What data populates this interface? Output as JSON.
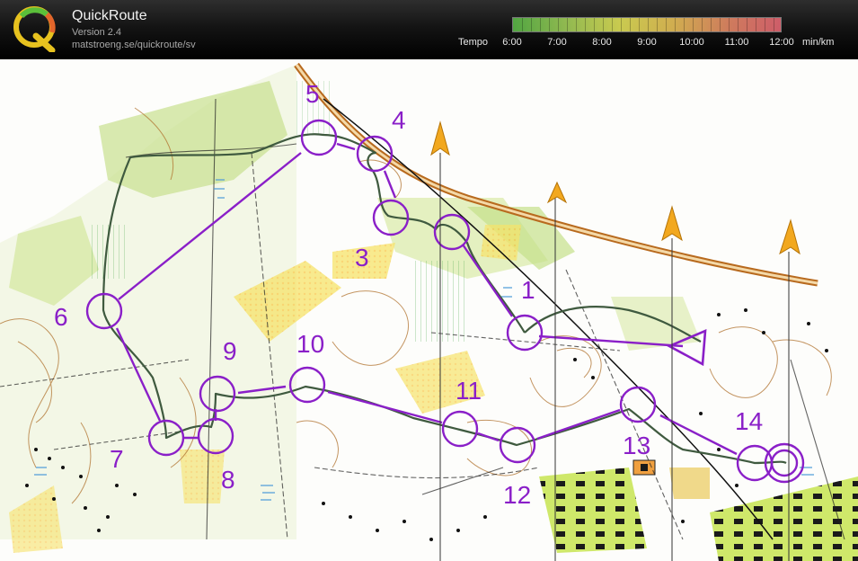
{
  "app": {
    "title": "QuickRoute",
    "version": "Version 2.4",
    "url": "matstroeng.se/quickroute/sv",
    "logo_letter": "Q"
  },
  "legend": {
    "label": "Tempo",
    "ticks": [
      "6:00",
      "7:00",
      "8:00",
      "9:00",
      "10:00",
      "11:00",
      "12:00"
    ],
    "unit": "min/km",
    "gradient_colors": [
      "#5cbf4a",
      "#a7d65b",
      "#e9ea5a",
      "#f1c85a",
      "#ef8f69",
      "#ee6a78"
    ]
  },
  "map": {
    "course_color": "#8a1fc8",
    "route_color": "#3f5a3f",
    "controls": [
      {
        "label": "1"
      },
      {
        "label": "3"
      },
      {
        "label": "4"
      },
      {
        "label": "5"
      },
      {
        "label": "6"
      },
      {
        "label": "7"
      },
      {
        "label": "8"
      },
      {
        "label": "9"
      },
      {
        "label": "10"
      },
      {
        "label": "11"
      },
      {
        "label": "12"
      },
      {
        "label": "13"
      },
      {
        "label": "14"
      }
    ]
  }
}
